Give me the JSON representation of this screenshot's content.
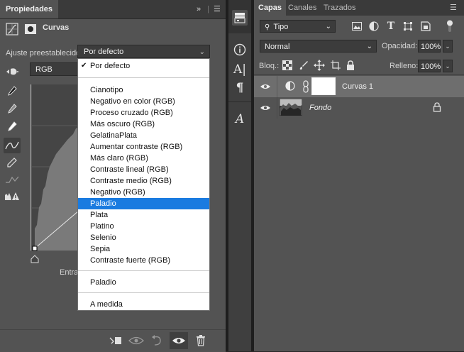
{
  "properties": {
    "tab_label": "Propiedades",
    "adjustment_title": "Curvas",
    "preset_label": "Ajuste preestablecido:",
    "preset_value": "Por defecto",
    "channel_value": "RGB",
    "input_label": "Entra",
    "dropdown": {
      "items": [
        {
          "label": "Por defecto",
          "checked": true
        },
        {
          "label": "Cianotipo"
        },
        {
          "label": "Negativo en color (RGB)"
        },
        {
          "label": "Proceso cruzado (RGB)"
        },
        {
          "label": "Más oscuro (RGB)"
        },
        {
          "label": "GelatinaPlata"
        },
        {
          "label": "Aumentar contraste (RGB)"
        },
        {
          "label": "Más claro (RGB)"
        },
        {
          "label": "Contraste lineal (RGB)"
        },
        {
          "label": "Contraste medio (RGB)"
        },
        {
          "label": "Negativo (RGB)"
        },
        {
          "label": "Paladio",
          "selected": true
        },
        {
          "label": "Plata"
        },
        {
          "label": "Platino"
        },
        {
          "label": "Selenio"
        },
        {
          "label": "Sepia"
        },
        {
          "label": "Contraste fuerte (RGB)"
        },
        {
          "label": "Paladio"
        },
        {
          "label": "A medida"
        }
      ]
    }
  },
  "layers": {
    "tabs": [
      "Capas",
      "Canales",
      "Trazados"
    ],
    "active_tab": "Capas",
    "kind_value": "Tipo",
    "blend_mode": "Normal",
    "opacity_label": "Opacidad:",
    "opacity_value": "100%",
    "lock_label": "Bloq.:",
    "fill_label": "Relleno:",
    "fill_value": "100%",
    "items": [
      {
        "name": "Curvas 1",
        "italic": false,
        "selected": true,
        "visible": true
      },
      {
        "name": "Fondo",
        "italic": true,
        "selected": false,
        "visible": true,
        "locked": true
      }
    ]
  },
  "colors": {
    "panel_bg": "#535353",
    "selection_blue": "#1a7be0",
    "selected_layer": "#6e6e6e"
  }
}
